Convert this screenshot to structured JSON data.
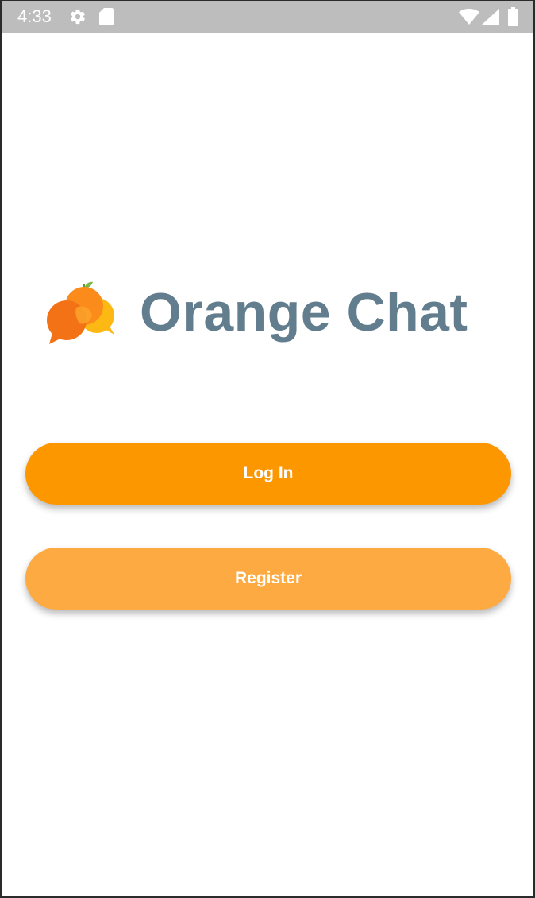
{
  "status_bar": {
    "time": "4:33",
    "icons": [
      "settings-icon",
      "sd-card-icon",
      "wifi-icon",
      "cell-signal-icon",
      "battery-icon"
    ],
    "background_color": "#bdbdbd"
  },
  "branding": {
    "app_name": "Orange Chat",
    "logo_icon": "orange-chat-bubbles-logo",
    "title_color": "#627d8d"
  },
  "actions": {
    "login_label": "Log In",
    "register_label": "Register",
    "login_color": "#fd9700",
    "register_color": "#fdaa42"
  }
}
